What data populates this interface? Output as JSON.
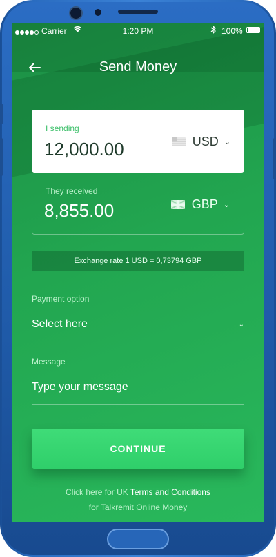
{
  "status_bar": {
    "carrier": "Carrier",
    "time": "1:20 PM",
    "battery": "100%"
  },
  "header": {
    "title": "Send Money"
  },
  "sending": {
    "label": "I sending",
    "amount": "12,000.00",
    "currency": "USD"
  },
  "received": {
    "label": "They received",
    "amount": "8,855.00",
    "currency": "GBP"
  },
  "exchange_rate": "Exchange rate 1 USD = 0,73794 GBP",
  "payment_option": {
    "label": "Payment option",
    "placeholder": "Select here"
  },
  "message": {
    "label": "Message",
    "placeholder": "Type your message"
  },
  "continue_label": "CONTINUE",
  "footer": {
    "line1_prefix": "Click here for UK",
    "line1_link": "Terms and Conditions",
    "line2": "for Talkremit Online Money"
  },
  "colors": {
    "accent": "#2fcf6a",
    "screen_bg": "#22a650",
    "label_green": "#3ec06b"
  },
  "icons": [
    "back-arrow-icon",
    "wifi-icon",
    "bluetooth-icon",
    "battery-icon",
    "us-flag-icon",
    "uk-flag-icon",
    "chevron-down-icon"
  ]
}
